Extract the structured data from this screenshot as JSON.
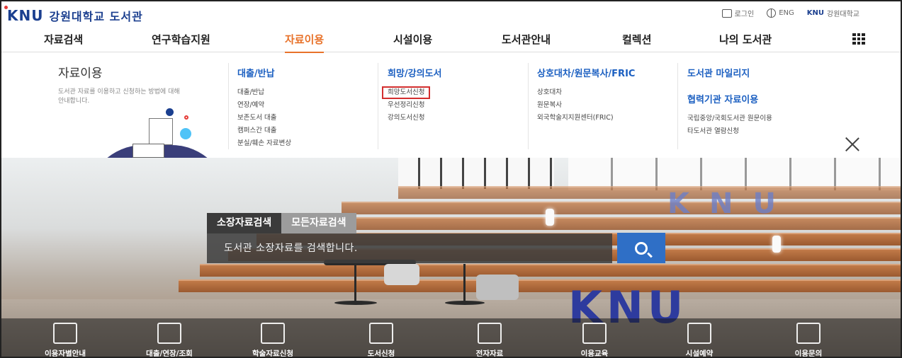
{
  "header": {
    "logo_mark": "KNU",
    "logo_text": "강원대학교 도서관",
    "util": {
      "login": "로그인",
      "lang": "ENG",
      "univ_mark": "KNU",
      "univ_text": "강원대학교"
    }
  },
  "gnb": {
    "items": [
      {
        "label": "자료검색"
      },
      {
        "label": "연구학습지원"
      },
      {
        "label": "자료이용",
        "active": true
      },
      {
        "label": "시설이용"
      },
      {
        "label": "도서관안내"
      },
      {
        "label": "컬렉션"
      },
      {
        "label": "나의 도서관"
      }
    ],
    "grid_icon": "grid-menu-icon"
  },
  "mega": {
    "title": "자료이용",
    "desc": "도서관 자료를 이용하고 신청하는 방법에 대해 안내합니다.",
    "columns": [
      {
        "heading": "대출/반납",
        "items": [
          "대출/반납",
          "연장/예약",
          "보존도서 대출",
          "캠퍼스간 대출",
          "분실/훼손 자료변상"
        ]
      },
      {
        "heading": "희망/강의도서",
        "items": [
          "희망도서신청",
          "우선정리신청",
          "강의도서신청"
        ],
        "highlighted": "희망도서신청"
      },
      {
        "heading": "상호대차/원문복사/FRIC",
        "items": [
          "상호대차",
          "원문복사",
          "외국학술지지원센터(FRIC)"
        ]
      },
      {
        "heading": "도서관 마일리지",
        "items": [],
        "heading2": "협력기관 자료이용",
        "items2": [
          "국립중앙/국회도서관 원문이용",
          "타도서관 열람신청"
        ]
      }
    ]
  },
  "search": {
    "tab_active": "소장자료검색",
    "tab_other": "모든자료검색",
    "placeholder": "도서관 소장자료를 검색합니다."
  },
  "quick_menu": {
    "items": [
      {
        "label": "이용자별안내",
        "icon": "users-icon"
      },
      {
        "label": "대출/연장/조회",
        "icon": "book-stand-icon"
      },
      {
        "label": "학술자료신청",
        "icon": "edit-doc-icon"
      },
      {
        "label": "도서신청",
        "icon": "book-icon"
      },
      {
        "label": "전자자료",
        "icon": "monitor-icon"
      },
      {
        "label": "이용교육",
        "icon": "education-icon"
      },
      {
        "label": "시설예약",
        "icon": "building-icon"
      },
      {
        "label": "이용문의",
        "icon": "chat-question-icon"
      }
    ]
  },
  "colors": {
    "brand": "#1b3f8f",
    "active": "#e8722a",
    "link": "#1b5fc1",
    "search_button": "#2f6fc6",
    "highlight_box": "#d32f2f"
  }
}
